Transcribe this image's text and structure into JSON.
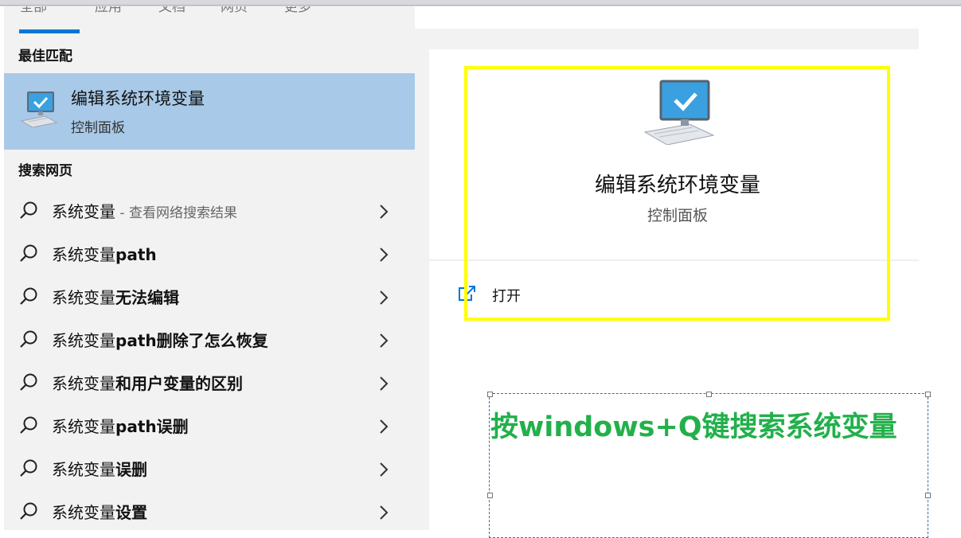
{
  "tabs": [
    "全部",
    "应用",
    "文档",
    "网页",
    "更多"
  ],
  "best_match": {
    "section_title": "最佳匹配",
    "title": "编辑系统环境变量",
    "subtitle": "控制面板",
    "icon": "monitor-check-icon"
  },
  "web_search": {
    "section_title": "搜索网页",
    "items": [
      {
        "prefix": "系统变量",
        "bold": "",
        "suffix": " - 查看网络搜索结果"
      },
      {
        "prefix": "系统变量",
        "bold": "path",
        "suffix": ""
      },
      {
        "prefix": "系统变量",
        "bold": "无法编辑",
        "suffix": ""
      },
      {
        "prefix": "系统变量",
        "bold": "path删除了怎么恢复",
        "suffix": ""
      },
      {
        "prefix": "系统变量",
        "bold": "和用户变量的区别",
        "suffix": ""
      },
      {
        "prefix": "系统变量",
        "bold": "path误删",
        "suffix": ""
      },
      {
        "prefix": "系统变量",
        "bold": "误删",
        "suffix": ""
      },
      {
        "prefix": "系统变量",
        "bold": "设置",
        "suffix": ""
      }
    ]
  },
  "detail": {
    "title": "编辑系统环境变量",
    "subtitle": "控制面板",
    "open_label": "打开"
  },
  "annotation": {
    "text": "按windows+Q键搜索系统变量"
  },
  "colors": {
    "accent": "#0078d7",
    "selection": "#a8c9e7",
    "highlight": "#ffff00",
    "annotation": "#22b04b"
  }
}
